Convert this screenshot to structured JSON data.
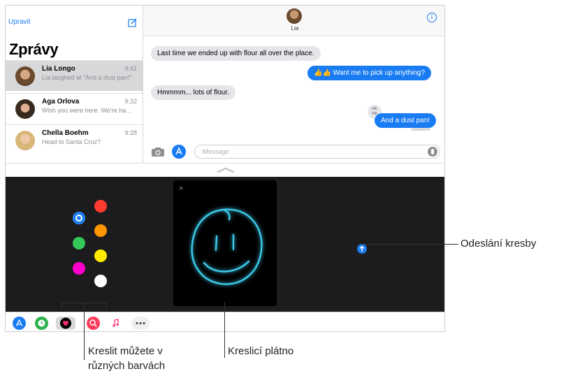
{
  "sidebar": {
    "edit_label": "Upravit",
    "title": "Zprávy",
    "conversations": [
      {
        "name": "Lia Longo",
        "time": "9:41",
        "preview": "Lia laughed at “And a dust pan!”"
      },
      {
        "name": "Aga Orlova",
        "time": "9:32",
        "preview": "Wish you were here. We're ha..."
      },
      {
        "name": "Chella Boehm",
        "time": "9:28",
        "preview": "Head to Santa Cruz?"
      }
    ]
  },
  "conversation": {
    "contact_name": "Lia",
    "messages": [
      {
        "text": "Last time we ended up with flour all over the place.",
        "from": "incoming"
      },
      {
        "text": "👍👍 Want me to pick up anything?",
        "from": "outgoing"
      },
      {
        "text": "Hmmmm... lots of flour.",
        "from": "incoming"
      },
      {
        "text": "And a dust pan!",
        "from": "outgoing"
      }
    ],
    "tapback": "HA\nHA",
    "delivered_label": "Doručeno",
    "input_placeholder": "iMessage"
  },
  "drawing": {
    "colors": [
      "#1a7cf2",
      "#ff3b30",
      "#ff9500",
      "#34c759",
      "#ffeb00",
      "#ff00cc",
      "#ffffff"
    ],
    "selected_color": "#1a7cf2",
    "stroke_color": "#3ccbea",
    "close_label": "×"
  },
  "callouts": {
    "send": "Odeslání kresby",
    "colors_line1": "Kreslit můžete v",
    "colors_line2": "různých barvách",
    "canvas": "Kreslicí plátno"
  }
}
